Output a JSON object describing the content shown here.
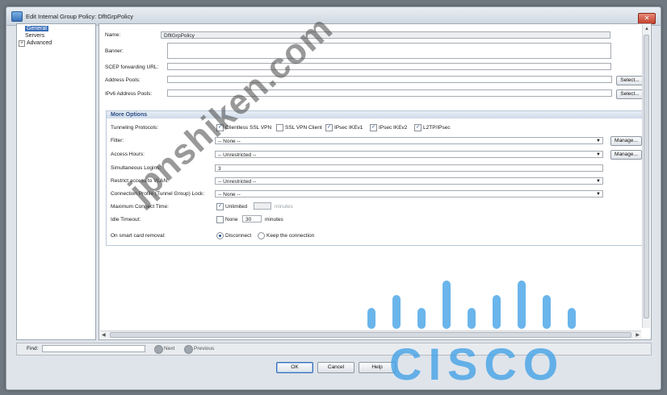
{
  "window": {
    "title": "Edit Internal Group Policy: DfltGrpPolicy",
    "close_glyph": "✕"
  },
  "tree": {
    "items": [
      {
        "label": "General",
        "selected": true
      },
      {
        "label": "Servers",
        "selected": false
      },
      {
        "label": "Advanced",
        "selected": false,
        "expander": "+"
      }
    ]
  },
  "form": {
    "name_label": "Name:",
    "name_value": "DfltGrpPolicy",
    "banner_label": "Banner:",
    "scep_label": "SCEP forwarding URL:",
    "address_pools_label": "Address Pools:",
    "ipv6_pools_label": "IPv6 Address Pools:",
    "select_button": "Select..."
  },
  "more_options": {
    "title": "More Options",
    "tunneling_label": "Tunneling Protocols:",
    "protocols": [
      {
        "label": "Clientless SSL VPN",
        "checked": true
      },
      {
        "label": "SSL VPN Client",
        "checked": false
      },
      {
        "label": "IPsec IKEv1",
        "checked": true
      },
      {
        "label": "IPsec IKEv2",
        "checked": true
      },
      {
        "label": "L2TP/IPsec",
        "checked": true
      }
    ],
    "filter_label": "Filter:",
    "filter_value": "-- None --",
    "access_hours_label": "Access Hours:",
    "access_hours_value": "-- Unrestricted --",
    "manage_button": "Manage...",
    "simul_label": "Simultaneous Logins:",
    "simul_value": "3",
    "vlan_label": "Restrict access to VLAN:",
    "vlan_value": "-- Unrestricted --",
    "conn_profile_label": "Connection Profile (Tunnel Group) Lock:",
    "conn_profile_value": "-- None --",
    "max_connect_label": "Maximum Connect Time:",
    "max_unlimited": "Unlimited",
    "max_minutes": "minutes",
    "idle_label": "Idle Timeout:",
    "idle_none": "None",
    "idle_value": "30",
    "idle_minutes": "minutes",
    "smart_card_label": "On smart card removal:",
    "smart_disconnect": "Disconnect",
    "smart_keep": "Keep the connection"
  },
  "find": {
    "label": "Find:",
    "next": "Next",
    "previous": "Previous"
  },
  "buttons": {
    "ok": "OK",
    "cancel": "Cancel",
    "help": "Help"
  },
  "overlay": {
    "watermark": "jpnshiken.com",
    "logo_text": "CISCO"
  },
  "colors": {
    "selection": "#3a6fb8",
    "cisco_blue": "#40a0e6"
  }
}
